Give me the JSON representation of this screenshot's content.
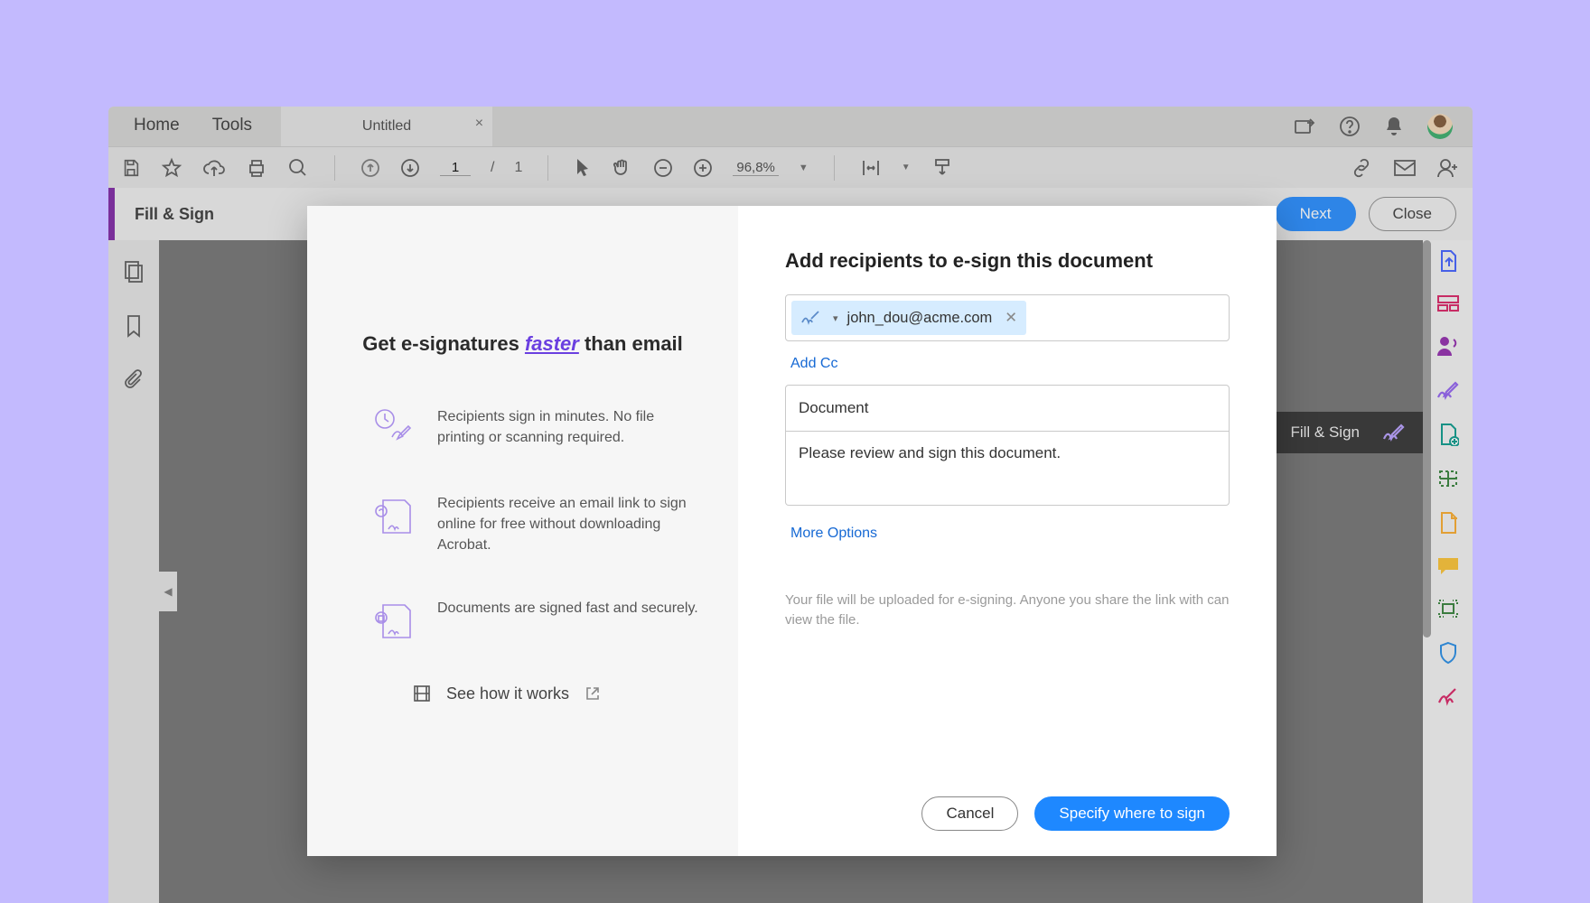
{
  "tabbar": {
    "home": "Home",
    "tools": "Tools",
    "doc_title": "Untitled"
  },
  "toolbar": {
    "page_current": "1",
    "page_sep": "/",
    "page_total": "1",
    "zoom": "96,8%"
  },
  "fsbar": {
    "title": "Fill & Sign",
    "next": "Next",
    "close": "Close"
  },
  "tooltip": {
    "label": "Fill & Sign"
  },
  "dialog": {
    "left": {
      "headline_a": "Get e-signatures ",
      "headline_em": "faster",
      "headline_b": " than email",
      "b1": "Recipients sign in minutes. No file printing or scanning required.",
      "b2": "Recipients receive an email link to sign online for free without downloading Acrobat.",
      "b3": "Documents are signed fast and securely.",
      "seehow": "See how it works"
    },
    "right": {
      "title": "Add recipients to e-sign this document",
      "recipient": "john_dou@acme.com",
      "add_cc": "Add Cc",
      "subject_value": "Document",
      "message_value": "Please review and sign this document.",
      "more_options": "More Options",
      "help": "Your file will be uploaded for e-signing. Anyone you share the link with can view the file.",
      "cancel": "Cancel",
      "submit": "Specify where to sign"
    }
  }
}
